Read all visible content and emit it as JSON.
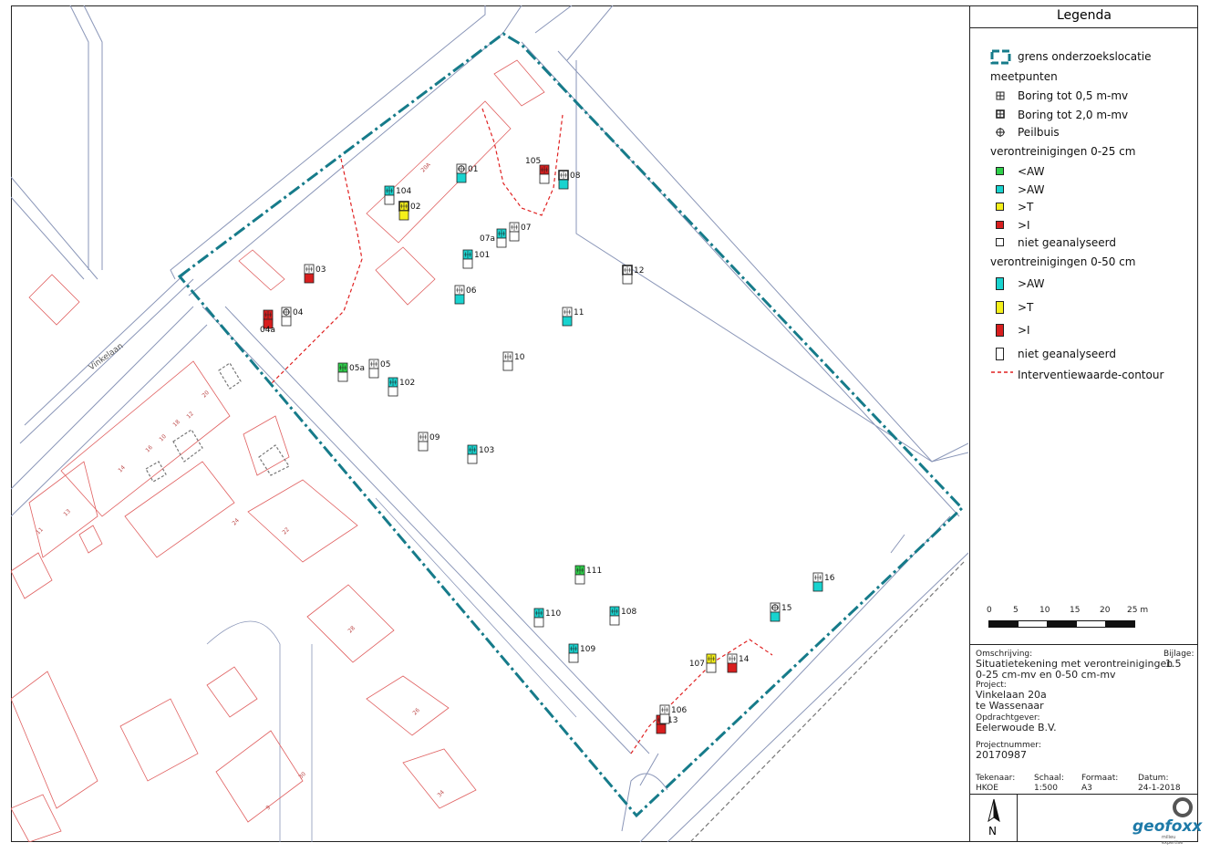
{
  "colors": {
    "boundary": "#167b8a",
    "parcel": "#e06060",
    "road": "#8a96b8",
    "contour": "#e02020",
    "green": "#2fd04a",
    "cyan": "#19d3cf",
    "yellow": "#f5f01a",
    "red": "#d81e1e",
    "white": "#ffffff"
  },
  "map": {
    "street_name": "Vinkelaan",
    "house_numbers": [
      "20A",
      "20",
      "18",
      "16",
      "14",
      "12",
      "10",
      "24",
      "22",
      "28",
      "26",
      "30",
      "11",
      "13",
      "9",
      "34"
    ],
    "points": [
      {
        "id": "01",
        "type": "peilbuis",
        "top": "white",
        "bottom": "cyan"
      },
      {
        "id": "02",
        "type": "boring-2",
        "top": "yellow",
        "bottom": "yellow"
      },
      {
        "id": "03",
        "type": "boring-05",
        "top": "white",
        "bottom": "red"
      },
      {
        "id": "04",
        "type": "peilbuis",
        "top": "white",
        "bottom": "white"
      },
      {
        "id": "04a",
        "type": "boring-05",
        "top": "red",
        "bottom": "red"
      },
      {
        "id": "05",
        "type": "boring-05",
        "top": "white",
        "bottom": "white"
      },
      {
        "id": "05a",
        "type": "boring-05",
        "top": "green",
        "bottom": "white"
      },
      {
        "id": "06",
        "type": "boring-05",
        "top": "white",
        "bottom": "cyan"
      },
      {
        "id": "07",
        "type": "boring-05",
        "top": "white",
        "bottom": "white"
      },
      {
        "id": "07a",
        "type": "boring-05",
        "top": "cyan",
        "bottom": "white"
      },
      {
        "id": "08",
        "type": "boring-2",
        "top": "white",
        "bottom": "cyan"
      },
      {
        "id": "09",
        "type": "boring-05",
        "top": "white",
        "bottom": "white"
      },
      {
        "id": "10",
        "type": "boring-05",
        "top": "white",
        "bottom": "white"
      },
      {
        "id": "11",
        "type": "boring-05",
        "top": "white",
        "bottom": "cyan"
      },
      {
        "id": "12",
        "type": "boring-2",
        "top": "white",
        "bottom": "white"
      },
      {
        "id": "13",
        "type": "boring-05",
        "top": "red",
        "bottom": "red"
      },
      {
        "id": "14",
        "type": "boring-05",
        "top": "white",
        "bottom": "red"
      },
      {
        "id": "15",
        "type": "peilbuis",
        "top": "white",
        "bottom": "cyan"
      },
      {
        "id": "16",
        "type": "boring-05",
        "top": "white",
        "bottom": "cyan"
      },
      {
        "id": "101",
        "type": "boring-05",
        "top": "cyan",
        "bottom": "white"
      },
      {
        "id": "102",
        "type": "boring-05",
        "top": "cyan",
        "bottom": "white"
      },
      {
        "id": "103",
        "type": "boring-05",
        "top": "cyan",
        "bottom": "white"
      },
      {
        "id": "104",
        "type": "boring-05",
        "top": "cyan",
        "bottom": "white"
      },
      {
        "id": "105",
        "type": "boring-05",
        "top": "red",
        "bottom": "white"
      },
      {
        "id": "106",
        "type": "boring-05",
        "top": "white",
        "bottom": "white"
      },
      {
        "id": "107",
        "type": "boring-05",
        "top": "yellow",
        "bottom": "white"
      },
      {
        "id": "108",
        "type": "boring-05",
        "top": "cyan",
        "bottom": "white"
      },
      {
        "id": "109",
        "type": "boring-05",
        "top": "cyan",
        "bottom": "white"
      },
      {
        "id": "110",
        "type": "boring-05",
        "top": "cyan",
        "bottom": "white"
      },
      {
        "id": "111",
        "type": "boring-05",
        "top": "green",
        "bottom": "white"
      }
    ]
  },
  "legend": {
    "title": "Legenda",
    "boundary_label": "grens onderzoekslocatie",
    "measure_header": "meetpunten",
    "measure_items": [
      "Boring tot 0,5 m-mv",
      "Boring tot 2,0 m-mv",
      "Peilbuis"
    ],
    "contam1_header": "verontreinigingen 0-25 cm",
    "contam1_items": [
      {
        "label": "<AW",
        "color": "#2fd04a"
      },
      {
        "label": ">AW",
        "color": "#19d3cf"
      },
      {
        "label": ">T",
        "color": "#f5f01a"
      },
      {
        "label": ">I",
        "color": "#d81e1e"
      },
      {
        "label": "niet geanalyseerd",
        "color": "#ffffff"
      }
    ],
    "contam2_header": "verontreinigingen 0-50 cm",
    "contam2_items": [
      {
        "label": ">AW",
        "color": "#19d3cf"
      },
      {
        "label": ">T",
        "color": "#f5f01a"
      },
      {
        "label": ">I",
        "color": "#d81e1e"
      },
      {
        "label": "niet geanalyseerd",
        "color": "#ffffff"
      }
    ],
    "contour_label": "Interventiewaarde-contour",
    "scale_labels": [
      "0",
      "5",
      "10",
      "15",
      "20",
      "25 m"
    ]
  },
  "titleblock": {
    "omschrijving_label": "Omschrijving:",
    "omschrijving_value_1": "Situatietekening met verontreinigingen",
    "omschrijving_value_2": "0-25 cm-mv en 0-50 cm-mv",
    "bijlage_label": "Bijlage:",
    "bijlage_value": "1.5",
    "project_label": "Project:",
    "project_value_1": "Vinkelaan 20a",
    "project_value_2": "te Wassenaar",
    "opdrachtgever_label": "Opdrachtgever:",
    "opdrachtgever_value": "Eelerwoude B.V.",
    "projectnummer_label": "Projectnummer:",
    "projectnummer_value": "20170987",
    "tekenaar_label": "Tekenaar:",
    "tekenaar_value": "HKOE",
    "schaal_label": "Schaal:",
    "schaal_value": "1:500",
    "formaat_label": "Formaat:",
    "formaat_value": "A3",
    "datum_label": "Datum:",
    "datum_value": "24-1-2018",
    "north": "N",
    "logo_text": "geofoxx",
    "logo_sub": "milieu expertise"
  }
}
